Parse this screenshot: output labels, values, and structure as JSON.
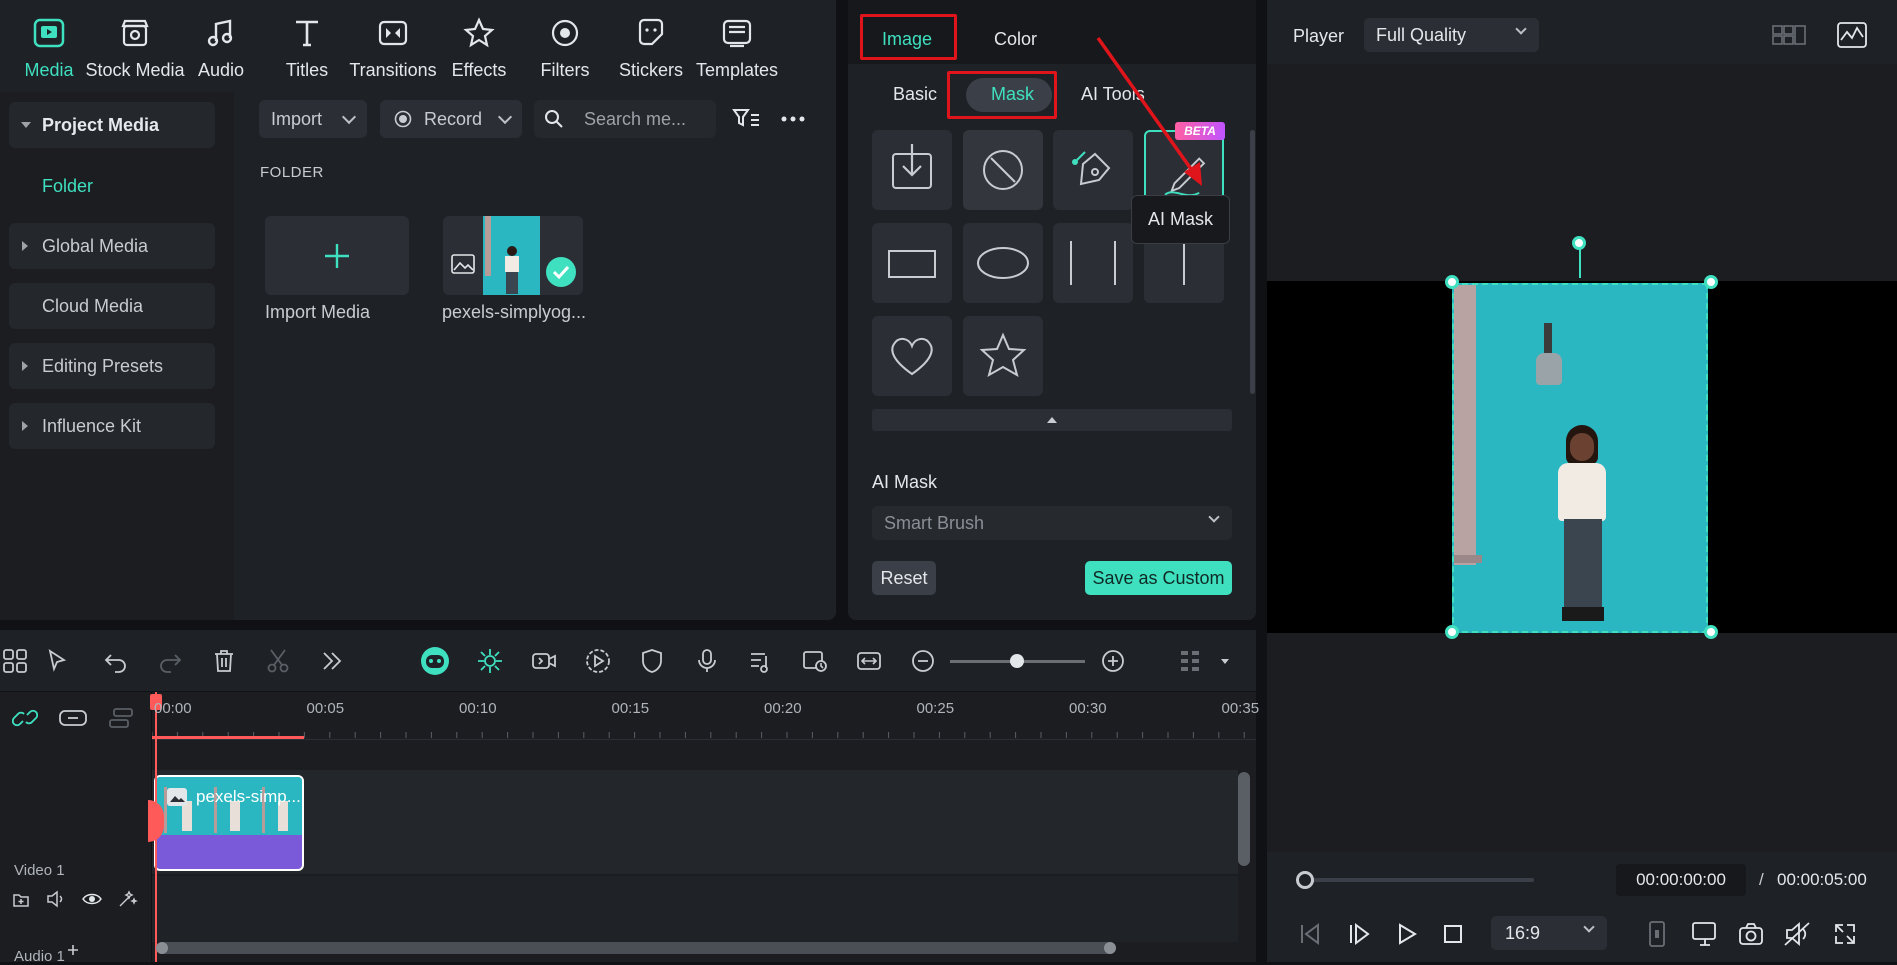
{
  "top_tabs": [
    {
      "label": "Media",
      "icon": "media-icon",
      "active": true
    },
    {
      "label": "Stock Media",
      "icon": "stock-media-icon"
    },
    {
      "label": "Audio",
      "icon": "audio-icon"
    },
    {
      "label": "Titles",
      "icon": "titles-icon"
    },
    {
      "label": "Transitions",
      "icon": "transitions-icon"
    },
    {
      "label": "Effects",
      "icon": "effects-icon"
    },
    {
      "label": "Filters",
      "icon": "filters-icon"
    },
    {
      "label": "Stickers",
      "icon": "stickers-icon"
    },
    {
      "label": "Templates",
      "icon": "templates-icon"
    }
  ],
  "left_nav": {
    "project_media": "Project Media",
    "folder": "Folder",
    "global_media": "Global Media",
    "cloud_media": "Cloud Media",
    "editing_presets": "Editing Presets",
    "influence_kit": "Influence Kit"
  },
  "media_toolbar": {
    "import_label": "Import",
    "record_label": "Record",
    "search_placeholder": "Search me..."
  },
  "media_bin": {
    "folder_heading": "FOLDER",
    "import_media_label": "Import Media",
    "clip_label": "pexels-simplyog..."
  },
  "properties": {
    "tab_image": "Image",
    "tab_color": "Color",
    "sub_basic": "Basic",
    "sub_mask": "Mask",
    "sub_ai_tools": "AI Tools",
    "beta_badge": "BETA",
    "tooltip": "AI Mask",
    "ai_mask_heading": "AI Mask",
    "smart_brush": "Smart Brush",
    "reset": "Reset",
    "save_custom": "Save as Custom"
  },
  "player": {
    "title": "Player",
    "quality": "Full Quality",
    "current_time": "00:00:00:00",
    "separator": "/",
    "total_time": "00:00:05:00",
    "ratio": "16:9"
  },
  "timeline": {
    "ruler_ticks": [
      "00:00",
      "00:05",
      "00:10",
      "00:15",
      "00:20",
      "00:25",
      "00:30",
      "00:35"
    ],
    "video_track": "Video 1",
    "audio_track": "Audio 1",
    "clip_name": "pexels-simp..."
  },
  "colors": {
    "accent": "#3fe0c0",
    "highlight_box": "#e0141b",
    "playhead": "#ff5a5a"
  }
}
